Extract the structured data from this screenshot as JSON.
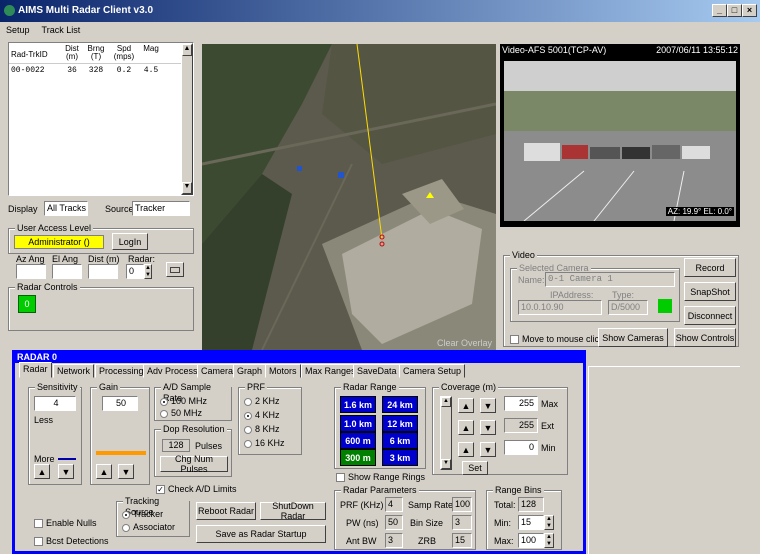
{
  "window": {
    "title": "AIMS Multi Radar Client v3.0",
    "min": "_",
    "max": "□",
    "close": "×"
  },
  "menu": [
    "Setup",
    "Track List"
  ],
  "tracklist": {
    "headers": {
      "id": "Rad-TrkID",
      "dist": "Dist\n(m)",
      "brng": "Brng\n(T)",
      "spd": "Spd\n(mps)",
      "mag": "Mag"
    },
    "rows": [
      {
        "id": "00-0022",
        "dist": "36",
        "brng": "328",
        "spd": "0.2",
        "mag": "4.5"
      }
    ]
  },
  "display": {
    "label": "Display",
    "value": "All Tracks",
    "source_label": "Source",
    "source_value": "Tracker"
  },
  "access": {
    "title": "User Access Level",
    "level": "Administrator ()",
    "login": "LogIn"
  },
  "pointing": {
    "az": "Az Ang",
    "el": "El Ang",
    "dist": "Dist (m)",
    "radar": "Radar:",
    "radar_value": "0"
  },
  "radar_controls": {
    "title": "Radar Controls",
    "value": "0"
  },
  "video": {
    "title": "Video-AFS 5001(TCP-AV)",
    "timestamp": "2007/06/11 13:55:12",
    "overlay": "AZ: 19.9° EL: 0.0°",
    "group": "Video",
    "selected_camera": "Selected Camera",
    "name_label": "Name:",
    "name_value": "0-1 Camera 1",
    "ip_label": "IPAddress:",
    "ip_value": "10.0.10.90",
    "type_label": "Type:",
    "type_value": "D/5000",
    "record": "Record",
    "snapshot": "SnapShot",
    "disconnect": "Disconnect",
    "move_mouse": "Move to mouse click",
    "show_cameras": "Show Cameras",
    "show_controls": "Show Controls"
  },
  "map": {
    "clear_overlay": "Clear Overlay"
  },
  "radar_panel": {
    "title": "RADAR 0",
    "tabs": [
      "Radar",
      "Network",
      "Processing",
      "Adv Process",
      "Camera",
      "Graph",
      "Motors",
      "Max Ranges",
      "SaveData",
      "Camera Setup"
    ],
    "sensitivity": {
      "title": "Sensitivity",
      "value": "4",
      "less": "Less",
      "more": "More"
    },
    "gain": {
      "title": "Gain",
      "value": "50"
    },
    "sample_rate": {
      "title": "A/D Sample Rate",
      "options": [
        "100 MHz",
        "50 MHz"
      ],
      "selected": 0
    },
    "dop_res": {
      "title": "Dop Resolution",
      "value": "128",
      "unit": "Pulses",
      "chg": "Chg Num Pulses"
    },
    "prf": {
      "title": "PRF",
      "options": [
        "2 KHz",
        "4 KHz",
        "8 KHz",
        "16 KHz"
      ],
      "selected": 1
    },
    "radar_range": {
      "title": "Radar Range",
      "buttons": [
        "1.6 km",
        "24 km",
        "1.0 km",
        "12 km",
        "600 m",
        "6 km",
        "300 m",
        "3 km"
      ],
      "selected": 6
    },
    "show_rings": "Show Range Rings",
    "coverage": {
      "title": "Coverage (m)",
      "max": "255",
      "max_label": "Max",
      "ext": "255",
      "ext_label": "Ext",
      "min": "0",
      "min_label": "Min",
      "set": "Set"
    },
    "check_ad": "Check A/D Limits",
    "tracking": {
      "title": "Tracking Source",
      "options": [
        "Tracker",
        "Associator"
      ],
      "selected": 0
    },
    "reboot": "Reboot Radar",
    "shutdown": "ShutDown Radar",
    "save_startup": "Save as Radar Startup",
    "enable_nulls": "Enable Nulls",
    "bcst": "Bcst Detections",
    "params": {
      "title": "Radar Parameters",
      "prf_label": "PRF (KHz)",
      "prf": "4",
      "samp_label": "Samp Rate",
      "samp": "100",
      "pw_label": "PW (ns)",
      "pw": "50",
      "bin_label": "Bin Size",
      "bin": "3",
      "bw_label": "Ant BW",
      "bw": "3",
      "zrb_label": "ZRB",
      "zrb": "15"
    },
    "bins": {
      "title": "Range Bins",
      "total_label": "Total:",
      "total": "128",
      "min_label": "Min:",
      "min": "15",
      "max_label": "Max:",
      "max": "100"
    }
  },
  "colors": {
    "panel_blue": "#0000ff",
    "range_btn": "#0000cc",
    "range_sel": "#008000",
    "admin_yellow": "#ffff00",
    "green_indicator": "#00cc00"
  }
}
